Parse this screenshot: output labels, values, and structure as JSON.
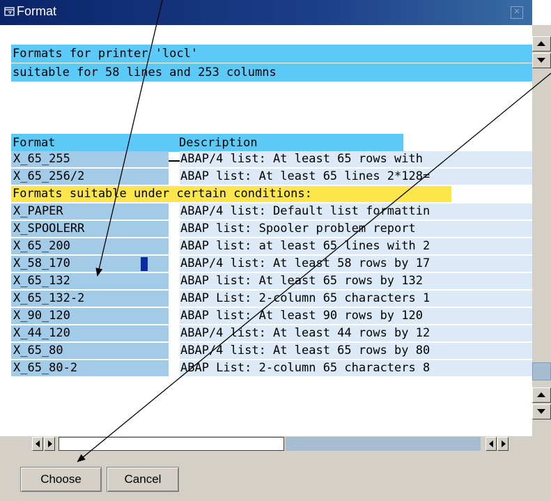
{
  "window": {
    "title": "Format",
    "close_icon": "close-icon"
  },
  "header": {
    "line1": "Formats for printer 'locl'",
    "line2": "suitable for 58 lines and 253 columns"
  },
  "columns": {
    "format": "Format",
    "description": "Description"
  },
  "rows_primary": [
    {
      "format": "X_65_255",
      "description": "ABAP/4 list: At least 65 rows with"
    },
    {
      "format": "X_65_256/2",
      "description": "ABAP list: At least 65 lines 2*128="
    }
  ],
  "section_label": "Formats suitable under certain conditions:",
  "rows_conditional": [
    {
      "format": "X_PAPER",
      "description": "ABAP/4 list: Default list formattin"
    },
    {
      "format": "X_SPOOLERR",
      "description": "ABAP list: Spooler problem report"
    },
    {
      "format": "X_65_200",
      "description": "ABAP list: at least 65 lines with 2"
    },
    {
      "format": "X_58_170",
      "description": "ABAP/4 list: At least 58 rows by 17"
    },
    {
      "format": "X_65_132",
      "description": "ABAP list: At least 65 rows by 132"
    },
    {
      "format": "X_65_132-2",
      "description": "ABAP List: 2-column 65 characters 1"
    },
    {
      "format": "X_90_120",
      "description": "ABAP list: At least 90 rows by 120"
    },
    {
      "format": "X_44_120",
      "description": "ABAP/4 list: At least 44 rows by 12"
    },
    {
      "format": "X_65_80",
      "description": "ABAP/4 list: At least 65 rows by 80"
    },
    {
      "format": "X_65_80-2",
      "description": "ABAP List: 2-column 65 characters 8"
    }
  ],
  "buttons": {
    "choose": "Choose",
    "cancel": "Cancel"
  },
  "colors": {
    "header_band": "#5ccaf8",
    "format_cell": "#a2cbe8",
    "desc_cell": "#dbeaf6",
    "section_band": "#fde64a",
    "titlebar": "#0a246a"
  }
}
